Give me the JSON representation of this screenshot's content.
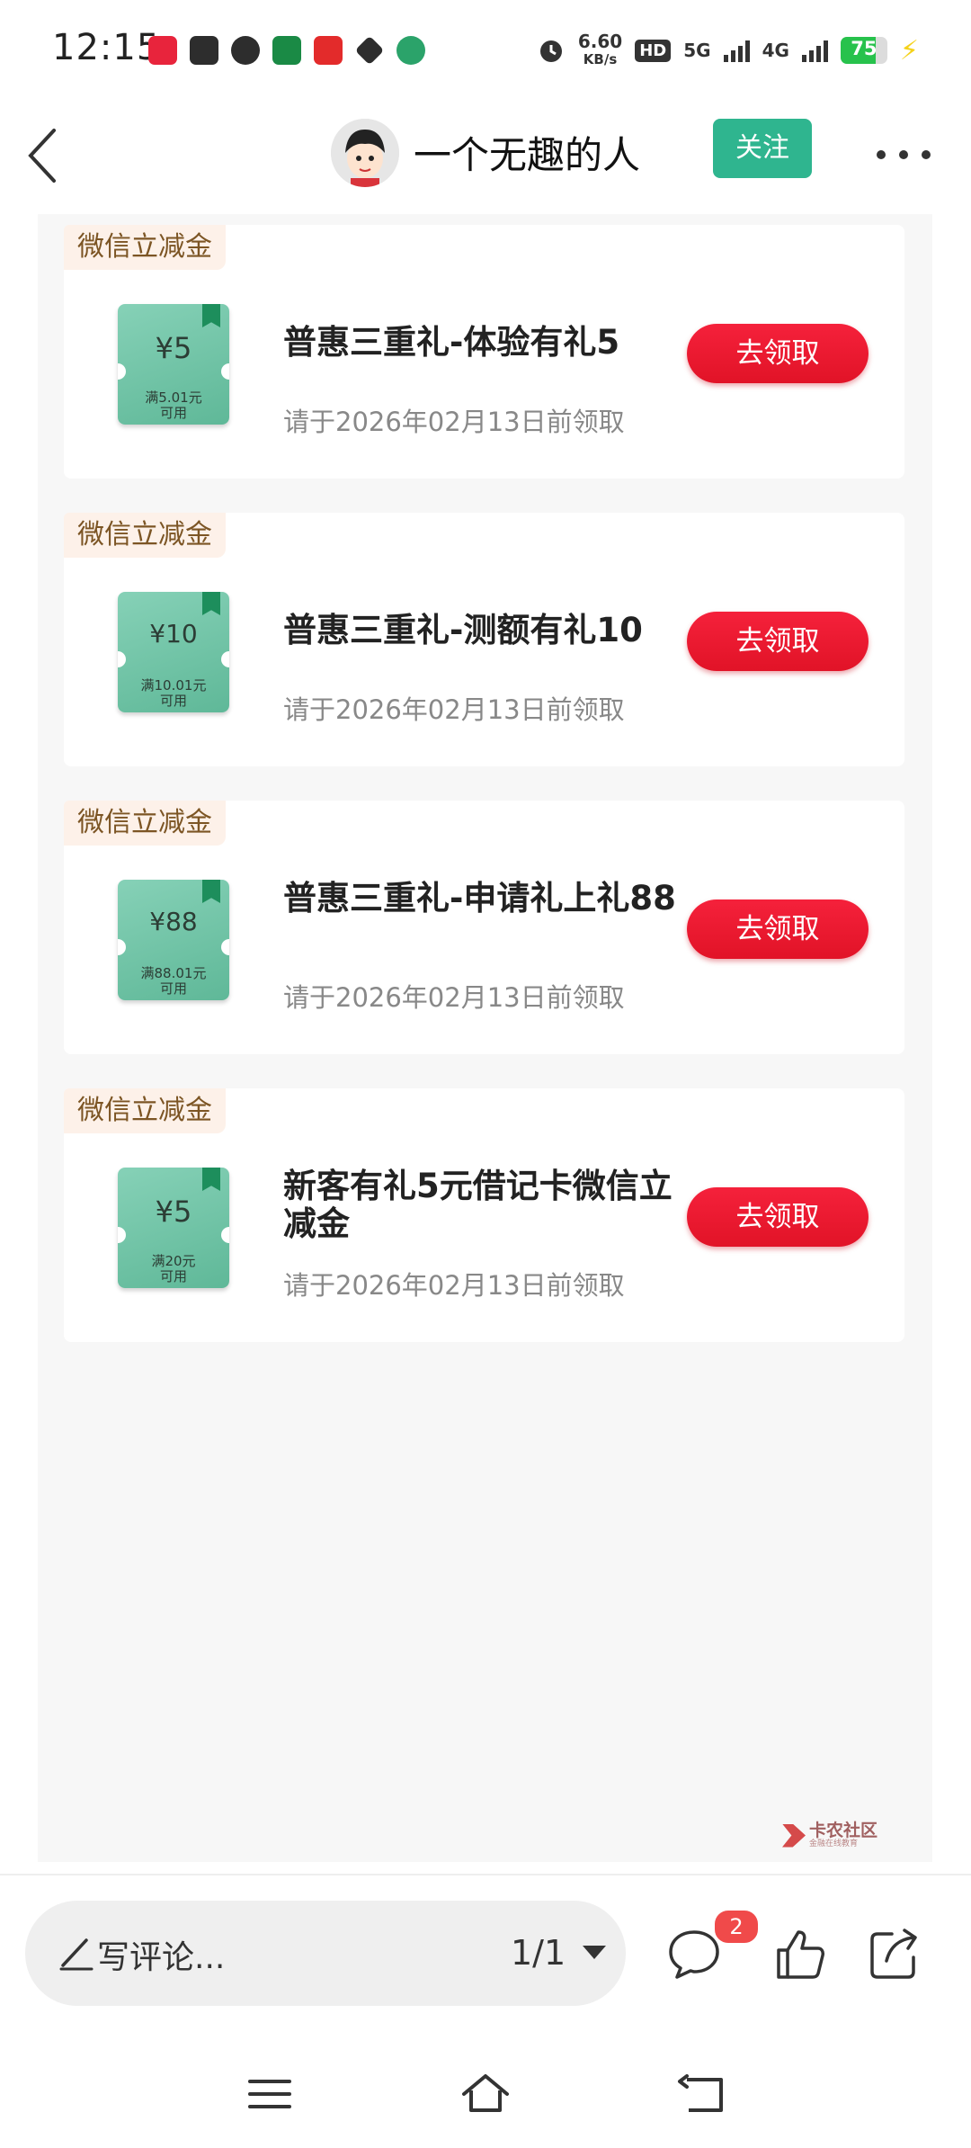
{
  "status_bar": {
    "time": "12:15",
    "speed_value": "6.60",
    "speed_unit": "KB/s",
    "hd": "HD",
    "net1": "5G",
    "net2": "4G",
    "battery": "75",
    "battery_level": 0.75,
    "notification_icons": [
      "pinduoduo-icon",
      "alipay-icon",
      "message-icon",
      "bank-icon",
      "red-app-icon",
      "diamond-icon",
      "rmb-icon"
    ]
  },
  "header": {
    "author": "一个无趣的人",
    "follow_label": "关注"
  },
  "cards": [
    {
      "tag": "微信立减金",
      "amount": "¥5",
      "condition_line1": "满5.01元",
      "condition_line2": "可用",
      "title": "普惠三重礼-体验有礼5",
      "deadline": "请于2026年02月13日前领取",
      "button": "去领取"
    },
    {
      "tag": "微信立减金",
      "amount": "¥10",
      "condition_line1": "满10.01元",
      "condition_line2": "可用",
      "title": "普惠三重礼-测额有礼10",
      "deadline": "请于2026年02月13日前领取",
      "button": "去领取"
    },
    {
      "tag": "微信立减金",
      "amount": "¥88",
      "condition_line1": "满88.01元",
      "condition_line2": "可用",
      "title": "普惠三重礼-申请礼上礼88",
      "deadline": "请于2026年02月13日前领取",
      "button": "去领取"
    },
    {
      "tag": "微信立减金",
      "amount": "¥5",
      "condition_line1": "满20元",
      "condition_line2": "可用",
      "title": "新客有礼5元借记卡微信立减金",
      "deadline": "请于2026年02月13日前领取",
      "button": "去领取"
    }
  ],
  "watermark": {
    "name": "卡农社区",
    "sub": "金融在线教育"
  },
  "bottom_bar": {
    "comment_placeholder": "写评论...",
    "page_indicator": "1/1",
    "comment_count": "2"
  }
}
